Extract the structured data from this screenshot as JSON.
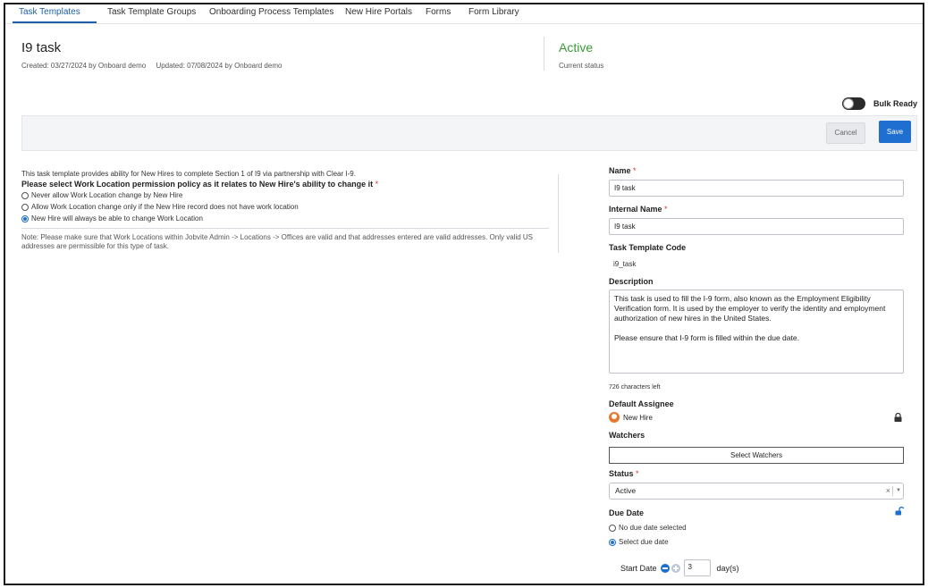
{
  "tabs": [
    {
      "label": "Task Templates",
      "active": true
    },
    {
      "label": "Task Template Groups"
    },
    {
      "label": "Onboarding Process Templates"
    },
    {
      "label": "New Hire Portals"
    },
    {
      "label": "Forms"
    },
    {
      "label": "Form Library"
    }
  ],
  "header": {
    "title": "I9 task",
    "created": "Created: 03/27/2024 by Onboard demo",
    "updated": "Updated: 07/08/2024 by Onboard demo",
    "status_value": "Active",
    "status_label": "Current status",
    "status_color": "#3a9a3a"
  },
  "bulk": {
    "label": "Bulk Ready",
    "on": false
  },
  "actions": {
    "cancel": "Cancel",
    "save": "Save",
    "save_color": "#1f6fd0"
  },
  "left": {
    "intro": "This task template provides ability for New Hires to complete Section 1 of I9 via partnership with Clear I-9.",
    "question": "Please select Work Location permission policy as it relates to New Hire's ability to change it",
    "required_mark": "*",
    "options": [
      {
        "label": "Never allow Work Location change by New Hire",
        "checked": false
      },
      {
        "label": "Allow Work Location change only if the New Hire record does not have work location",
        "checked": false
      },
      {
        "label": "New Hire will always be able to change Work Location",
        "checked": true
      }
    ],
    "note": "Note: Please make sure that Work Locations within Jobvite Admin -> Locations -> Offices are valid and that addresses entered are valid addresses. Only valid US addresses are permissible for this type of task."
  },
  "form": {
    "name_label": "Name",
    "name_value": "I9 task",
    "internal_name_label": "Internal Name",
    "internal_name_value": "I9 task",
    "code_label": "Task Template Code",
    "code_value": "i9_task",
    "description_label": "Description",
    "description_value": "This task is used to fill the I-9 form, also known as the Employment Eligibility Verification form. It is used by the employer to verify the identity and employment authorization of new hires in the United States.\n\nPlease ensure that I-9 form is filled within the due date.",
    "chars_left": "726 characters left",
    "assignee_label": "Default Assignee",
    "assignee_value": "New Hire",
    "watchers_label": "Watchers",
    "watchers_button": "Select Watchers",
    "status_label": "Status",
    "status_value": "Active",
    "due_label": "Due Date",
    "due_options": [
      {
        "label": "No due date selected",
        "checked": false
      },
      {
        "label": "Select due date",
        "checked": true
      }
    ],
    "start_label": "Start Date",
    "start_days": "3",
    "days_unit": "day(s)",
    "required_mark": "*"
  },
  "icons": {
    "lock": "lock-icon",
    "unlock": "unlock-icon",
    "avatar": "user-avatar-icon",
    "minus": "minus-circle-icon",
    "plus": "plus-circle-icon"
  }
}
